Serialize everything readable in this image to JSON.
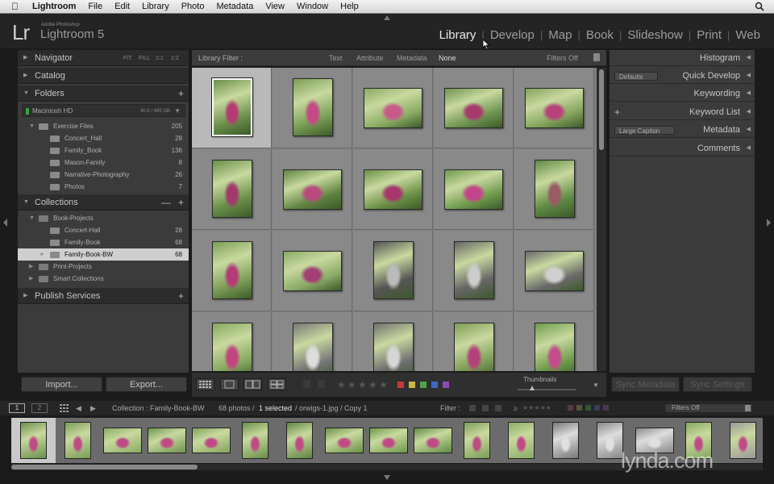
{
  "menubar": {
    "items": [
      "Lightroom",
      "File",
      "Edit",
      "Library",
      "Photo",
      "Metadata",
      "View",
      "Window",
      "Help"
    ]
  },
  "identity": {
    "badge": "Lr",
    "sub": "Adobe Photoshop",
    "name": "Lightroom 5"
  },
  "modules": [
    {
      "label": "Library",
      "active": true
    },
    {
      "label": "Develop",
      "active": false
    },
    {
      "label": "Map",
      "active": false
    },
    {
      "label": "Book",
      "active": false
    },
    {
      "label": "Slideshow",
      "active": false
    },
    {
      "label": "Print",
      "active": false
    },
    {
      "label": "Web",
      "active": false
    }
  ],
  "left": {
    "navigator": {
      "title": "Navigator",
      "controls": [
        "FIT",
        "FILL",
        "1:1",
        "1:2"
      ]
    },
    "catalog": {
      "title": "Catalog"
    },
    "folders": {
      "title": "Folders",
      "disk": {
        "name": "Macintosh HD",
        "space": "40.6 / 465 GB"
      },
      "items": [
        {
          "name": "Exercise Files",
          "count": "205",
          "level": 0,
          "expanded": true
        },
        {
          "name": "Concert_Hall",
          "count": "28",
          "level": 1
        },
        {
          "name": "Family_Book",
          "count": "136",
          "level": 1
        },
        {
          "name": "Mason-Family",
          "count": "8",
          "level": 1
        },
        {
          "name": "Narrative-Photography",
          "count": "26",
          "level": 1
        },
        {
          "name": "Photos",
          "count": "7",
          "level": 1
        }
      ]
    },
    "collections": {
      "title": "Collections",
      "items": [
        {
          "name": "Book-Projects",
          "count": "",
          "level": 0,
          "set": true,
          "expanded": true
        },
        {
          "name": "Concert-Hall",
          "count": "28",
          "level": 1
        },
        {
          "name": "Family-Book",
          "count": "68",
          "level": 1
        },
        {
          "name": "Family-Book-BW",
          "count": "68",
          "level": 1,
          "selected": true
        },
        {
          "name": "Print-Projects",
          "count": "",
          "level": 0,
          "set": true
        },
        {
          "name": "Smart Collections",
          "count": "",
          "level": 0,
          "set": true
        }
      ]
    },
    "publish": {
      "title": "Publish Services"
    },
    "import_label": "Import...",
    "export_label": "Export..."
  },
  "filterbar": {
    "title": "Library Filter :",
    "options": [
      "Text",
      "Attribute",
      "Metadata",
      "None"
    ],
    "state": "Filters Off"
  },
  "right": {
    "histogram": "Histogram",
    "quick_develop": {
      "title": "Quick Develop",
      "preset": "Defaults"
    },
    "keywording": "Keywording",
    "keyword_list": "Keyword List",
    "metadata": {
      "title": "Metadata",
      "preset": "Large Caption"
    },
    "comments": "Comments",
    "sync_metadata": "Sync Metadata",
    "sync_settings": "Sync Settings"
  },
  "toolbar": {
    "thumbnails_label": "Thumbnails",
    "thumb_size": 0.25
  },
  "filmbar": {
    "page1": "1",
    "page2": "2",
    "source": "Collection : Family-Book-BW",
    "count_text": "68 photos /",
    "selected_text": "1 selected",
    "file_text": "/ orwigs-1.jpg / Copy 1",
    "filter_label": "Filter :",
    "filter_state": "Filters Off"
  },
  "watermark": "lynda.com",
  "colors": {
    "label_red": "#c23b3b",
    "label_yellow": "#c7b83a",
    "label_green": "#4fa24a",
    "label_blue": "#3f66c4",
    "label_purple": "#8d49b8"
  },
  "icons": {
    "apple": "apple-icon",
    "spotlight": "search-icon",
    "lock": "lock-icon"
  }
}
